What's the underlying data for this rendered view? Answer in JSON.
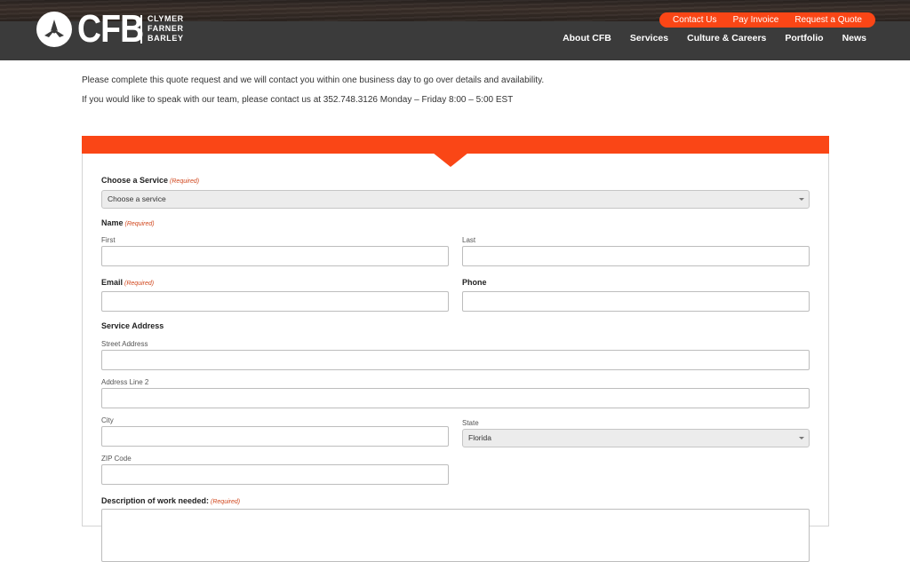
{
  "brand": {
    "logo_letters": "CFB",
    "logo_words": [
      "CLYMER",
      "FARNER",
      "BARLEY"
    ],
    "accent_color": "#fa4616"
  },
  "utility_nav": [
    "Contact Us",
    "Pay Invoice",
    "Request a Quote"
  ],
  "main_nav": [
    "About CFB",
    "Services",
    "Culture & Careers",
    "Portfolio",
    "News"
  ],
  "intro": {
    "line1": "Please complete this quote request and we will contact you within one business day to go over details and availability.",
    "line2": "If you would like to speak with our team, please contact us at 352.748.3126 Monday – Friday 8:00 – 5:00 EST"
  },
  "form": {
    "required_text": "(Required)",
    "service": {
      "label": "Choose a Service",
      "value": "Choose a service"
    },
    "name": {
      "label": "Name",
      "first": "First",
      "last": "Last"
    },
    "email": {
      "label": "Email"
    },
    "phone": {
      "label": "Phone"
    },
    "address": {
      "label": "Service Address",
      "street": "Street Address",
      "line2": "Address Line 2",
      "city": "City",
      "state": "State",
      "state_value": "Florida",
      "zip": "ZIP Code"
    },
    "description": {
      "label": "Description of work needed:"
    }
  }
}
